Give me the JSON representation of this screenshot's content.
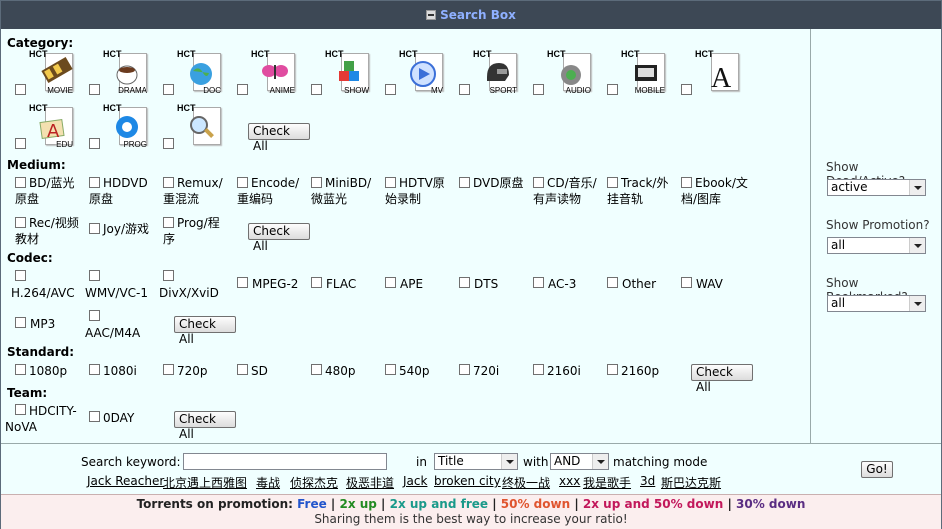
{
  "title": "Search Box",
  "category": {
    "label": "Category:",
    "icons": [
      {
        "hct": "HCT",
        "name": "MOVIE",
        "icon": "film-reel-icon"
      },
      {
        "hct": "HCT",
        "name": "DRAMA",
        "icon": "coffee-cup-icon"
      },
      {
        "hct": "HCT",
        "name": "DOC",
        "icon": "globe-icon"
      },
      {
        "hct": "HCT",
        "name": "ANIME",
        "icon": "butterfly-icon"
      },
      {
        "hct": "HCT",
        "name": "SHOW",
        "icon": "colored-cubes-icon"
      },
      {
        "hct": "HCT",
        "name": "MV",
        "icon": "play-disc-icon"
      },
      {
        "hct": "HCT",
        "name": "SPORT",
        "icon": "helmet-icon"
      },
      {
        "hct": "HCT",
        "name": "AUDIO",
        "icon": "speaker-icon"
      },
      {
        "hct": "HCT",
        "name": "MOBILE",
        "icon": "phone-icon"
      },
      {
        "hct": "HCT",
        "name": "",
        "icon": "letter-a-icon"
      },
      {
        "hct": "HCT",
        "name": "EDU",
        "icon": "education-icon"
      },
      {
        "hct": "HCT",
        "name": "PROG",
        "icon": "gear-icon"
      },
      {
        "hct": "HCT",
        "name": "",
        "icon": "magnifier-document-icon"
      }
    ],
    "check_all": "Check All"
  },
  "medium": {
    "label": "Medium:",
    "options": [
      {
        "l1": "BD/蓝光",
        "l2": "原盘"
      },
      {
        "l1": "HDDVD",
        "l2": "原盘"
      },
      {
        "l1": "Remux/",
        "l2": "重混流"
      },
      {
        "l1": "Encode/",
        "l2": "重编码"
      },
      {
        "l1": "MiniBD/",
        "l2": "微蓝光"
      },
      {
        "l1": "HDTV原",
        "l2": "始录制"
      },
      {
        "l1": "DVD原盘",
        "l2": ""
      },
      {
        "l1": "CD/音乐/",
        "l2": "有声读物"
      },
      {
        "l1": "Track/外",
        "l2": "挂音轨"
      },
      {
        "l1": "Ebook/文",
        "l2": "档/图库"
      },
      {
        "l1": "Rec/视频",
        "l2": "教材"
      },
      {
        "l1": "Joy/游戏",
        "l2": ""
      },
      {
        "l1": "Prog/程",
        "l2": "序"
      }
    ],
    "check_all": "Check All"
  },
  "codec": {
    "label": "Codec:",
    "options": [
      "H.264/AVC",
      "WMV/VC-1",
      "DivX/XviD",
      "MPEG-2",
      "FLAC",
      "APE",
      "DTS",
      "AC-3",
      "Other",
      "WAV",
      "MP3",
      "AAC/M4A"
    ],
    "check_all": "Check All"
  },
  "standard": {
    "label": "Standard:",
    "options": [
      "1080p",
      "1080i",
      "720p",
      "SD",
      "480p",
      "540p",
      "720i",
      "2160i",
      "2160p"
    ],
    "check_all": "Check All"
  },
  "team": {
    "label": "Team:",
    "options": [
      "HDCITY-NoVA",
      "0DAY"
    ],
    "check_all": "Check All"
  },
  "side": {
    "dead_label": "Show Dead/Active?",
    "dead_value": "active",
    "promo_label": "Show Promotion?",
    "promo_value": "all",
    "bookmark_label": "Show Bookmarked?",
    "bookmark_value": "all",
    "go": "Go!"
  },
  "search": {
    "keyword_label": "Search keyword:",
    "keyword_value": "",
    "in_label": "in",
    "in_value": "Title",
    "with_label": "with",
    "with_value": "AND",
    "mode_label": "matching mode",
    "hot_keywords": [
      "Jack Reacher",
      "北京遇上西雅图",
      "毒战",
      "侦探杰克",
      "极恶非道",
      "Jack",
      "broken city",
      "终极一战",
      "xxx",
      "我是歌手",
      "3d",
      "斯巴达克斯"
    ]
  },
  "promotion": {
    "label": "Torrents on promotion:",
    "items": [
      {
        "text": "Free",
        "color": "#2255cc"
      },
      {
        "text": "2x up",
        "color": "#228b22"
      },
      {
        "text": "2x up and free",
        "color": "#1a9a8a"
      },
      {
        "text": "50% down",
        "color": "#e0552f"
      },
      {
        "text": "2x up and 50% down",
        "color": "#c2185b"
      },
      {
        "text": "30% down",
        "color": "#5a2d82"
      }
    ],
    "separator": "|",
    "tagline": "Sharing them is the best way to increase your ratio!"
  }
}
